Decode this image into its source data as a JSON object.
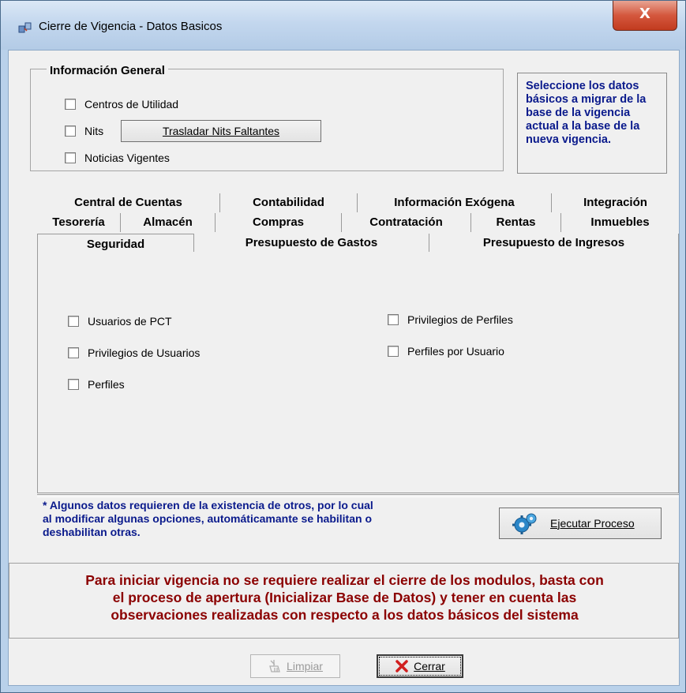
{
  "window": {
    "title": "Cierre de Vigencia - Datos Basicos",
    "close_label": "X"
  },
  "general": {
    "legend": "Información General",
    "items": [
      "Centros de Utilidad",
      "Nits",
      "Noticias Vigentes"
    ],
    "trasladar_label": "Trasladar Nits Faltantes"
  },
  "info_text": "Seleccione los datos básicos a migrar de la base de la vigencia actual a la base de la nueva vigencia.",
  "tabs": {
    "row1": [
      "Central de Cuentas",
      "Contabilidad",
      "Información Exógena",
      "Integración"
    ],
    "row2": [
      "Tesorería",
      "Almacén",
      "Compras",
      "Contratación",
      "Rentas",
      "Inmuebles"
    ],
    "row3": [
      "Seguridad",
      "Presupuesto de Gastos",
      "Presupuesto de Ingresos"
    ],
    "active": "Seguridad"
  },
  "seguridad": {
    "left": [
      "Usuarios de PCT",
      "Privilegios de Usuarios",
      "Perfiles"
    ],
    "right": [
      "Privilegios de Perfiles",
      "Perfiles por Usuario"
    ]
  },
  "note_lines": [
    "* Algunos datos requieren de la existencia de otros, por lo cual",
    "al modificar algunas opciones, automáticamante se habilitan o",
    "deshabilitan otras."
  ],
  "ejecutar_label": "Ejecutar Proceso",
  "warning_lines": [
    "Para iniciar vigencia no se requiere realizar el cierre de los modulos, basta con",
    "el proceso de apertura (Inicializar Base de Datos) y tener en cuenta las",
    "observaciones realizadas con respecto a los datos básicos del sistema"
  ],
  "footer": {
    "limpiar_label": "Limpiar",
    "cerrar_label": "Cerrar"
  },
  "colors": {
    "note": "#0a1a8c",
    "warning": "#8b0000",
    "close_button": "#c23b1f"
  }
}
